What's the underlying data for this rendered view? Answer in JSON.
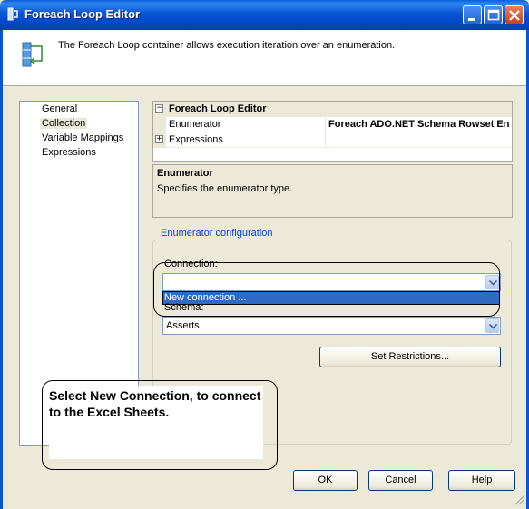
{
  "window": {
    "title": "Foreach Loop Editor"
  },
  "header": {
    "description": "The Foreach Loop container allows execution iteration over an enumeration."
  },
  "nav": {
    "items": [
      "General",
      "Collection",
      "Variable Mappings",
      "Expressions"
    ],
    "selected": "Collection"
  },
  "grid": {
    "category": "Foreach Loop Editor",
    "rows": [
      {
        "label": "Enumerator",
        "value": "Foreach ADO.NET Schema Rowset En"
      },
      {
        "label": "Expressions",
        "value": ""
      }
    ]
  },
  "description_panel": {
    "title": "Enumerator",
    "text": "Specifies the enumerator type."
  },
  "config": {
    "group_title": "Enumerator configuration",
    "connection_label": "Connection:",
    "connection_value": "",
    "dropdown_item": "New connection ...",
    "schema_label": "Schema:",
    "schema_value": "Asserts",
    "set_restrictions": "Set Restrictions..."
  },
  "annotation": {
    "text": "Select New Connection, to connect to the Excel Sheets."
  },
  "buttons": {
    "ok": "OK",
    "cancel": "Cancel",
    "help": "Help"
  },
  "colors": {
    "titlebar": "#0a55d4",
    "selection": "#316ac5",
    "group_title": "#0046d5"
  }
}
